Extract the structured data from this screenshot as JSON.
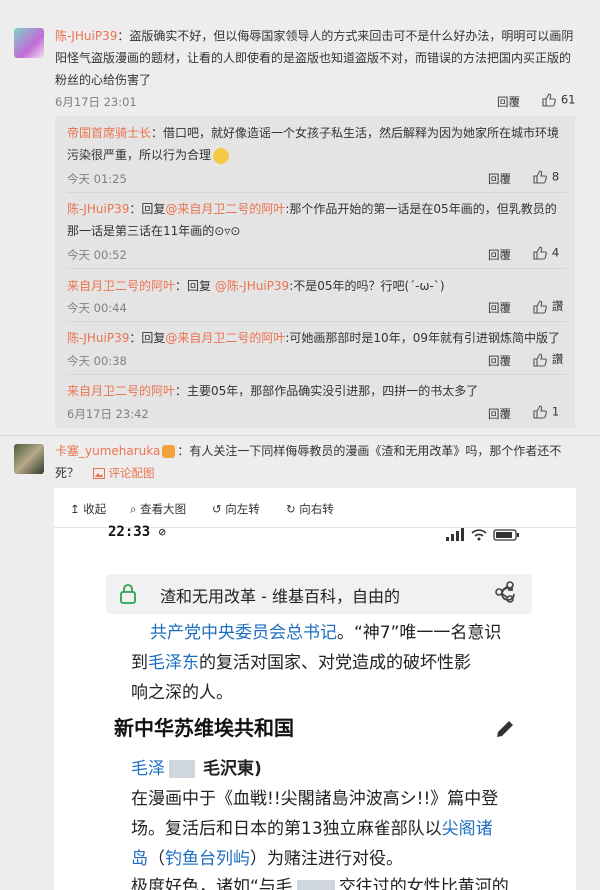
{
  "comments": [
    {
      "user": "陈-JHuiP39",
      "text_l1": "：盗版确实不好，但以侮辱国家领导人的方式来回击可不是什么好办法，明明可以画阴",
      "text_l2": "阳怪气盗版漫画的题材，让看的人即使看的是盗版也知道盗版不对，而错误的方法把国内买正版的",
      "text_l3": "粉丝的心给伤害了",
      "time": "6月17日 23:01",
      "reply_label": "回覆",
      "likes": "61",
      "replies": [
        {
          "user": "帝国首席骑士长",
          "text": "：借口吧，就好像造谣一个女孩子私生活，然后解释为因为她家所在城市环境",
          "text2": "污染很严重，所以行为合理",
          "time": "今天 01:25",
          "reply_label": "回覆",
          "likes": "8"
        },
        {
          "user": "陈-JHuiP39",
          "text": "：回复",
          "mention": "@来自月卫二号的阿叶",
          "text_after": ":那个作品开始的第一话是在05年画的，但乳教员的",
          "text2": "那一话是第三话在11年画的⊙▿⊙",
          "time": "今天 00:52",
          "reply_label": "回覆",
          "likes": "4"
        },
        {
          "user": "来自月卫二号的阿叶",
          "text": "：回复 ",
          "mention": "@陈-JHuiP39",
          "text_after": ":不是05年的吗？行吧(´-ω-`)",
          "time": "今天 00:44",
          "reply_label": "回覆",
          "likes": "讚"
        },
        {
          "user": "陈-JHuiP39",
          "text": "：回复",
          "mention": "@来自月卫二号的阿叶",
          "text_after": ":可她画那部时是10年，09年就有引进钢炼简中版了",
          "time": "今天 00:38",
          "reply_label": "回覆",
          "likes": "讚"
        },
        {
          "user": "来自月卫二号的阿叶",
          "text": "：主要05年，那部作品确实没引进那，四拼一的书太多了",
          "time": "6月17日 23:42",
          "reply_label": "回覆",
          "likes": "1"
        }
      ]
    },
    {
      "user": "卡塞_yumeharuka",
      "text_l1": "：有人关注一下同样侮辱教员的漫画《渣和无用改革》吗，那个作者还不",
      "text_l2": "死？",
      "img_label": "评论配图"
    }
  ],
  "viewer": {
    "tools": [
      "收起",
      "查看大图",
      "向左转",
      "向右转"
    ]
  },
  "phone": {
    "clock": "22:33",
    "url_title": "渣和无用改革 - 维基百科，自由的",
    "lines": {
      "l1_link": "共产党中央委员会总书记",
      "l1_rest": "。“神7”唯一一名意识",
      "l2_a": "到",
      "l2_link": "毛泽东",
      "l2_rest": "的复活对国家、对党造成的破坏性影",
      "l3": "响之深的人。",
      "heading": "新中华苏维埃共和国",
      "l5_link": "毛泽",
      "l5_rest": "毛沢東)",
      "l6": "在漫画中于《血戦!!尖閣諸島沖波高シ!!》篇中登",
      "l7": "场。复活后和日本的第13独立麻雀部队以",
      "l7_link": "尖阁诸",
      "l8_link_a": "岛",
      "l8_mid": "（",
      "l8_link_b": "钓鱼台列屿",
      "l8_rest": "）为赌注进行对役。",
      "l9": "极度好色，诸如“与毛",
      "l9_rest": "交往过的女性比黄河的"
    }
  }
}
